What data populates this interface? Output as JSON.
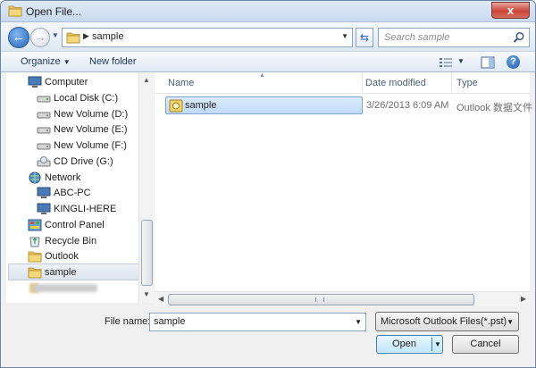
{
  "window": {
    "title": "Open File...",
    "close_label": "x"
  },
  "navbar": {
    "address_path": "sample",
    "search_placeholder": "Search sample"
  },
  "toolbar": {
    "organize_label": "Organize",
    "new_folder_label": "New folder"
  },
  "nav_pane": {
    "items": [
      {
        "label": "Computer",
        "icon": "computer-icon"
      },
      {
        "label": "Local Disk (C:)",
        "icon": "drive-icon"
      },
      {
        "label": "New Volume (D:)",
        "icon": "drive-icon"
      },
      {
        "label": "New Volume (E:)",
        "icon": "drive-icon"
      },
      {
        "label": "New Volume (F:)",
        "icon": "drive-icon"
      },
      {
        "label": "CD Drive (G:)",
        "icon": "cd-drive-icon"
      },
      {
        "label": "Network",
        "icon": "network-icon"
      },
      {
        "label": "ABC-PC",
        "icon": "computer-icon"
      },
      {
        "label": "KINGLI-HERE",
        "icon": "computer-icon"
      },
      {
        "label": "Control Panel",
        "icon": "control-panel-icon"
      },
      {
        "label": "Recycle Bin",
        "icon": "recycle-bin-icon"
      },
      {
        "label": "Outlook",
        "icon": "folder-icon"
      },
      {
        "label": "sample",
        "icon": "folder-icon"
      }
    ]
  },
  "file_list": {
    "columns": {
      "name": "Name",
      "date": "Date modified",
      "type": "Type"
    },
    "rows": [
      {
        "name": "sample",
        "date": "3/26/2013 6:09 AM",
        "type": "Outlook 数据文件"
      }
    ]
  },
  "bottom": {
    "file_name_label": "File name:",
    "file_name_value": "sample",
    "filter_value": "Microsoft Outlook Files(*.pst)",
    "open_label": "Open",
    "cancel_label": "Cancel"
  }
}
